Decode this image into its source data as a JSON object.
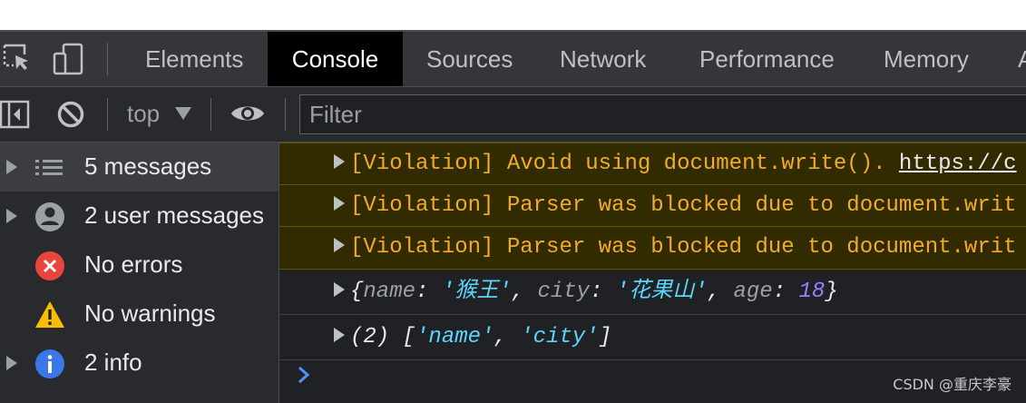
{
  "tabs": [
    {
      "label": "Elements",
      "active": false
    },
    {
      "label": "Console",
      "active": true
    },
    {
      "label": "Sources",
      "active": false
    },
    {
      "label": "Network",
      "active": false
    },
    {
      "label": "Performance",
      "active": false
    },
    {
      "label": "Memory",
      "active": false
    }
  ],
  "toolbar": {
    "context": "top",
    "filter_placeholder": "Filter"
  },
  "sidebar": {
    "items": [
      {
        "label": "5 messages",
        "icon": "list-icon",
        "expandable": true,
        "selected": true
      },
      {
        "label": "2 user messages",
        "icon": "user-icon",
        "expandable": true,
        "selected": false
      },
      {
        "label": "No errors",
        "icon": "error-icon",
        "expandable": false,
        "selected": false
      },
      {
        "label": "No warnings",
        "icon": "warning-icon",
        "expandable": false,
        "selected": false
      },
      {
        "label": "2 info",
        "icon": "info-icon",
        "expandable": true,
        "selected": false
      }
    ]
  },
  "console": {
    "violations": [
      {
        "tag": "[Violation]",
        "text": "Avoid using document.write().",
        "link": "https://c"
      },
      {
        "tag": "[Violation]",
        "text": "Parser was blocked due to document.writ",
        "link": ""
      },
      {
        "tag": "[Violation]",
        "text": "Parser was blocked due to document.writ",
        "link": ""
      }
    ],
    "object_log": {
      "open": "{",
      "k1": "name",
      "v1": "'猴王'",
      "k2": "city",
      "v2": "'花果山'",
      "k3": "age",
      "v3": "18",
      "close": "}"
    },
    "array_log": {
      "count": "(2)",
      "open": "[",
      "v1": "'name'",
      "v2": "'city'",
      "close": "]"
    },
    "prompt": ">"
  },
  "watermark": "CSDN @重庆李豪",
  "colors": {
    "warning_text": "#f2ab26",
    "warning_bg": "#332b00",
    "string": "#5cd5fb",
    "number": "#9980ff",
    "error": "#e8453c",
    "info": "#3b78e7",
    "warning_icon": "#fbbc04"
  }
}
